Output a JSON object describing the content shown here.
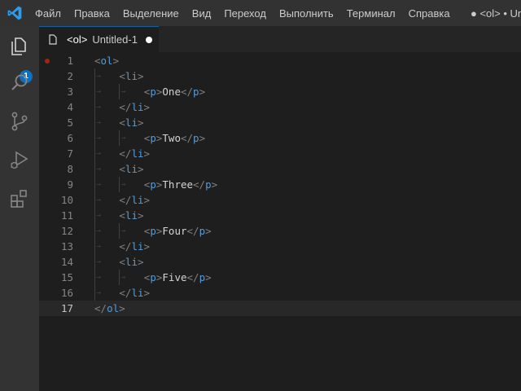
{
  "menu": {
    "items": [
      "Файл",
      "Правка",
      "Выделение",
      "Вид",
      "Переход",
      "Выполнить",
      "Терминал",
      "Справка"
    ],
    "window_title": "● <ol> • Un"
  },
  "activity": {
    "explorer_badge": "1"
  },
  "tab": {
    "tag": "<ol>",
    "name": "Untitled-1"
  },
  "editor": {
    "current_line": 17,
    "lines": [
      {
        "n": "1",
        "indent": 0,
        "tag": "ol",
        "close": false,
        "text": ""
      },
      {
        "n": "2",
        "indent": 1,
        "tag": "li",
        "close": false,
        "text": ""
      },
      {
        "n": "3",
        "indent": 2,
        "tag": "p",
        "close": false,
        "text": "One"
      },
      {
        "n": "4",
        "indent": 1,
        "tag": "li",
        "close": true,
        "text": ""
      },
      {
        "n": "5",
        "indent": 1,
        "tag": "li",
        "close": false,
        "text": ""
      },
      {
        "n": "6",
        "indent": 2,
        "tag": "p",
        "close": false,
        "text": "Two"
      },
      {
        "n": "7",
        "indent": 1,
        "tag": "li",
        "close": true,
        "text": ""
      },
      {
        "n": "8",
        "indent": 1,
        "tag": "li",
        "close": false,
        "text": ""
      },
      {
        "n": "9",
        "indent": 2,
        "tag": "p",
        "close": false,
        "text": "Three"
      },
      {
        "n": "10",
        "indent": 1,
        "tag": "li",
        "close": true,
        "text": ""
      },
      {
        "n": "11",
        "indent": 1,
        "tag": "li",
        "close": false,
        "text": ""
      },
      {
        "n": "12",
        "indent": 2,
        "tag": "p",
        "close": false,
        "text": "Four"
      },
      {
        "n": "13",
        "indent": 1,
        "tag": "li",
        "close": true,
        "text": ""
      },
      {
        "n": "14",
        "indent": 1,
        "tag": "li",
        "close": false,
        "text": ""
      },
      {
        "n": "15",
        "indent": 2,
        "tag": "p",
        "close": false,
        "text": "Five"
      },
      {
        "n": "16",
        "indent": 1,
        "tag": "li",
        "close": true,
        "text": ""
      },
      {
        "n": "17",
        "indent": 0,
        "tag": "ol",
        "close": true,
        "text": ""
      }
    ]
  },
  "colors": {
    "accent": "#0e70c0",
    "tag": "#569cd6",
    "bracket": "#808080",
    "text": "#d4d4d4",
    "breakpoint": "#a1260d"
  }
}
